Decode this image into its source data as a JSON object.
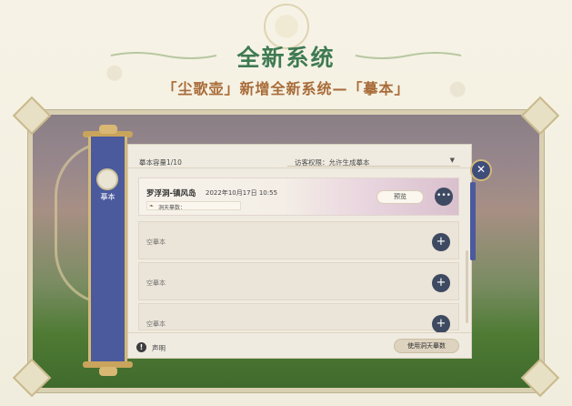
{
  "header": {
    "title": "全新系统",
    "subtitle": "「尘歌壶」新增全新系统—「摹本」"
  },
  "scroll": {
    "label": "摹本"
  },
  "panel": {
    "capacity": "摹本容量1/10",
    "visitor_permission": "访客权限：允许生成摹本",
    "slots": [
      {
        "title": "罗浮洞-镇风岛",
        "date": "2022年10月17日 10:55",
        "sub_label": "洞天摹数：",
        "preview_label": "预览",
        "more_icon": "•••"
      },
      {
        "label": "空摹本",
        "add_icon": "+"
      },
      {
        "label": "空摹本",
        "add_icon": "+"
      },
      {
        "label": "空摹本",
        "add_icon": "+"
      }
    ],
    "notice_icon": "!",
    "notice_label": "声明",
    "use_button_label": "使用洞天摹数"
  },
  "close_icon": "✕",
  "colors": {
    "headline": "#3f7a52",
    "subheadline": "#a86b38",
    "scroll_blue": "#4b5a9c",
    "panel_bg": "#f0ebe1",
    "round_button": "#3e4a61"
  }
}
